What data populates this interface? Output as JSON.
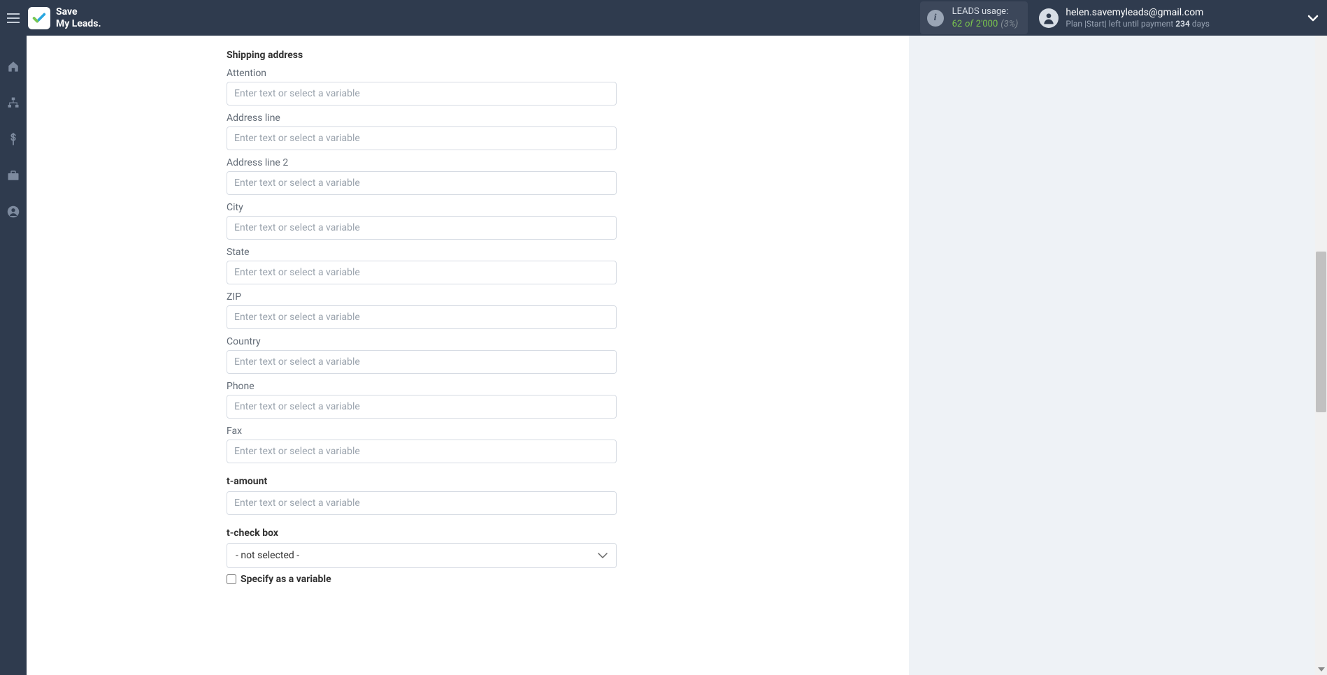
{
  "brand": {
    "line1": "Save",
    "line2": "My Leads."
  },
  "usage": {
    "label": "LEADS usage:",
    "current": "62",
    "of": "of",
    "total": "2'000",
    "pct": "(3%)"
  },
  "user": {
    "email": "helen.savemyleads@gmail.com",
    "plan_prefix": "Plan ",
    "plan_name": "|Start|",
    "plan_mid": " left until payment ",
    "plan_days": "234",
    "plan_suffix": " days"
  },
  "form": {
    "section_title": "Shipping address",
    "placeholder": "Enter text or select a variable",
    "fields": {
      "attention": "Attention",
      "address_line": "Address line",
      "address_line2": "Address line 2",
      "city": "City",
      "state": "State",
      "zip": "ZIP",
      "country": "Country",
      "phone": "Phone",
      "fax": "Fax"
    },
    "t_amount_label": "t-amount",
    "t_checkbox_label": "t-check box",
    "select_value": "- not selected -",
    "specify_var": "Specify as a variable"
  }
}
